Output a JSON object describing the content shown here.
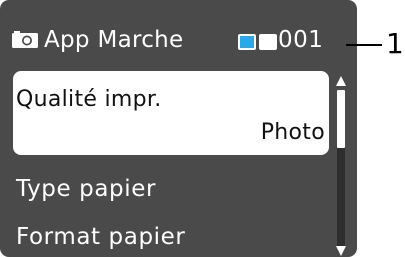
{
  "header": {
    "icon": "camera-icon",
    "title": "App Marche",
    "counter": "001",
    "media_indicators": [
      {
        "name": "memory-card-icon",
        "color": "#2aa8e8"
      },
      {
        "name": "memory-card-icon",
        "color": "#ffffff"
      }
    ]
  },
  "menu": {
    "items": [
      {
        "label": "Qualité impr.",
        "value": "Photo",
        "selected": true
      },
      {
        "label": "Type papier"
      },
      {
        "label": "Format papier"
      }
    ]
  },
  "scrollbar": {
    "position": 0.0
  },
  "callout": {
    "label": "1"
  },
  "colors": {
    "screen_bg": "#4a4a4a",
    "selection_bg": "#ffffff",
    "text_light": "#ffffff",
    "text_dark": "#111111"
  }
}
